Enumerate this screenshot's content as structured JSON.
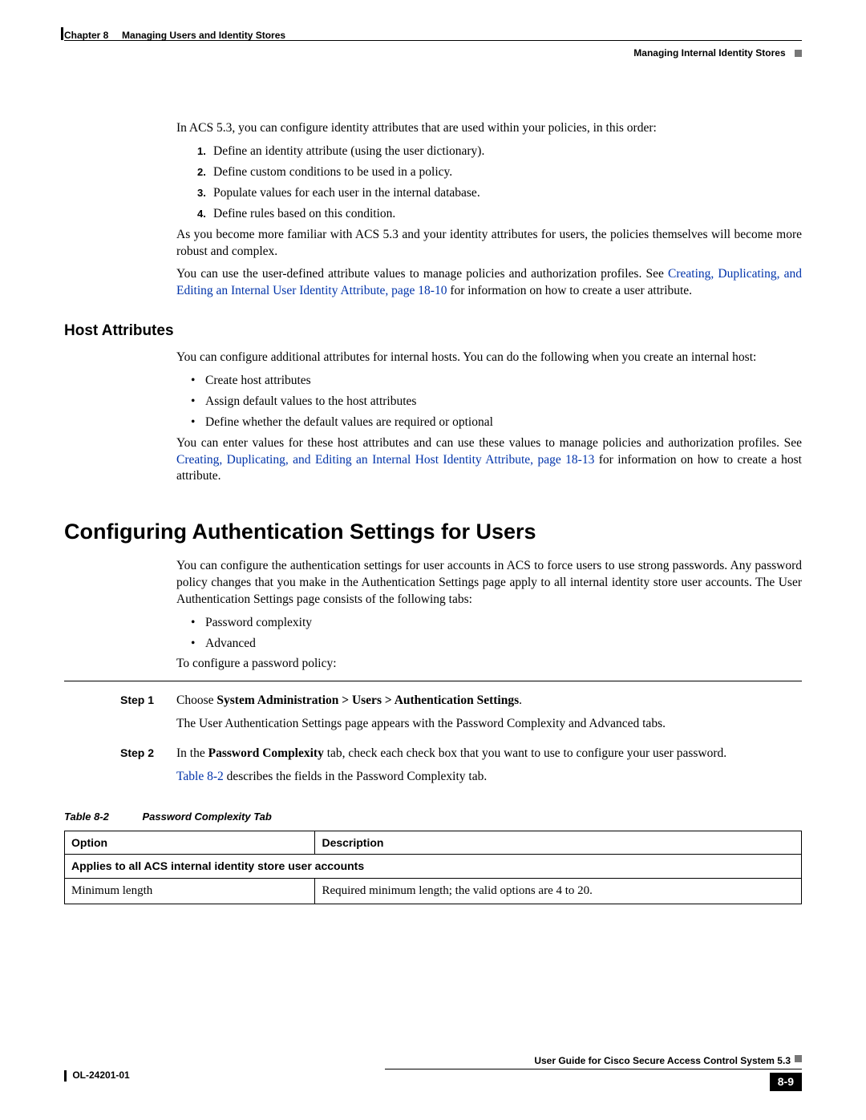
{
  "header": {
    "chapter_label": "Chapter 8",
    "chapter_title": "Managing Users and Identity Stores",
    "section_right": "Managing Internal Identity Stores"
  },
  "intro": {
    "p1": "In ACS 5.3, you can configure identity attributes that are used within your policies, in this order:",
    "list": [
      "Define an identity attribute (using the user dictionary).",
      "Define custom conditions to be used in a policy.",
      "Populate values for each user in the internal database.",
      "Define rules based on this condition."
    ],
    "p2": "As you become more familiar with ACS 5.3 and your identity attributes for users, the policies themselves will become more robust and complex.",
    "p3_a": "You can use the user-defined attribute values to manage policies and authorization profiles. See ",
    "p3_link": "Creating, Duplicating, and Editing an Internal User Identity Attribute, page 18-10",
    "p3_b": " for information on how to create a user attribute."
  },
  "host": {
    "heading": "Host Attributes",
    "p1": "You can configure additional attributes for internal hosts. You can do the following when you create an internal host:",
    "bullets": [
      "Create host attributes",
      "Assign default values to the host attributes",
      "Define whether the default values are required or optional"
    ],
    "p2_a": "You can enter values for these host attributes and can use these values to manage policies and authorization profiles. See ",
    "p2_link": "Creating, Duplicating, and Editing an Internal Host Identity Attribute, page 18-13",
    "p2_b": " for information on how to create a host attribute."
  },
  "auth": {
    "heading": "Configuring Authentication Settings for Users",
    "p1": "You can configure the authentication settings for user accounts in ACS to force users to use strong passwords. Any password policy changes that you make in the Authentication Settings page apply to all internal identity store user accounts. The User Authentication Settings page consists of the following tabs:",
    "bullets": [
      "Password complexity",
      "Advanced"
    ],
    "p2": "To configure a password policy:",
    "steps": [
      {
        "label": "Step 1",
        "line1_a": "Choose ",
        "line1_bold": "System Administration > Users > Authentication Settings",
        "line1_b": ".",
        "line2": "The User Authentication Settings page appears with the Password Complexity and Advanced tabs."
      },
      {
        "label": "Step 2",
        "line1_a": "In the ",
        "line1_bold": "Password Complexity",
        "line1_b": " tab, check each check box that you want to use to configure your user password.",
        "line2_link": "Table 8-2",
        "line2_b": " describes the fields in the Password Complexity tab."
      }
    ],
    "table": {
      "caption_num": "Table 8-2",
      "caption_title": "Password Complexity Tab",
      "head_option": "Option",
      "head_desc": "Description",
      "section_row": "Applies to all ACS internal identity store user accounts",
      "rows": [
        {
          "option": "Minimum length",
          "desc": "Required minimum length; the valid options are 4 to 20."
        }
      ]
    }
  },
  "footer": {
    "guide_title": "User Guide for Cisco Secure Access Control System 5.3",
    "doc_number": "OL-24201-01",
    "page_number": "8-9"
  }
}
